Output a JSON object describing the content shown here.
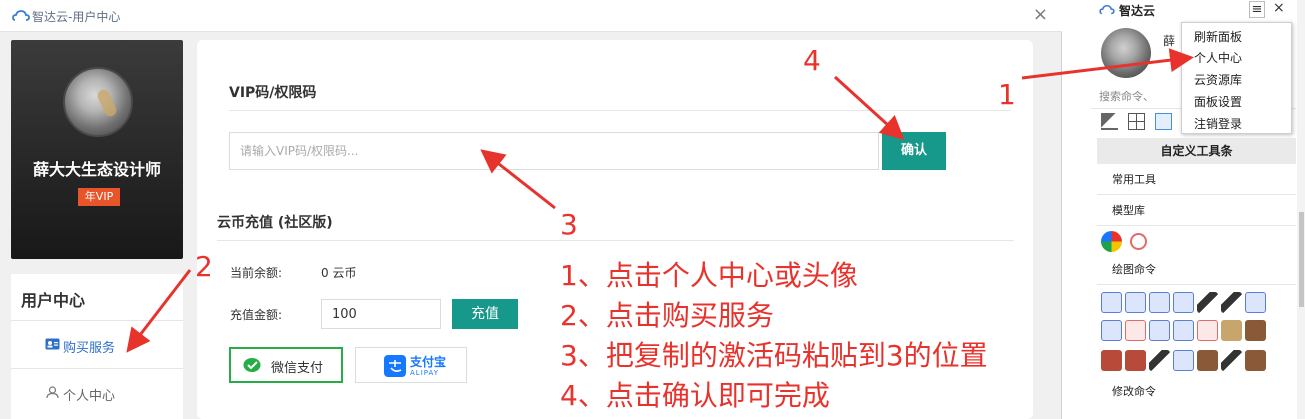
{
  "window": {
    "title": "智达云-用户中心",
    "close_label": "×"
  },
  "profile": {
    "name": "薛大大生态设计师",
    "vip_badge": "年VIP"
  },
  "user_center": {
    "title": "用户中心",
    "items": [
      {
        "label": "购买服务",
        "icon": "member-card-icon"
      },
      {
        "label": "个人中心",
        "icon": "user-icon"
      }
    ]
  },
  "vip_section": {
    "title": "VIP码/权限码",
    "placeholder": "请输入VIP码/权限码...",
    "confirm_label": "确认"
  },
  "coin_section": {
    "title": "云币充值 (社区版)",
    "balance_label": "当前余额:",
    "balance_value": "0 云币",
    "amount_label": "充值金额:",
    "amount_value": "100",
    "recharge_label": "充值",
    "wechat_label": "微信支付",
    "alipay_label": "支付宝",
    "alipay_sub": "ALIPAY"
  },
  "side_panel": {
    "title": "智达云",
    "menu_label": "≡",
    "close_label": "×",
    "name_clip": "薛",
    "search_placeholder": "搜索命令、",
    "toolbar_title": "自定义工具条",
    "sections": [
      "常用工具",
      "模型库",
      "绘图命令",
      "修改命令"
    ]
  },
  "dropdown_menu": [
    "刷新面板",
    "个人中心",
    "云资源库",
    "面板设置",
    "注销登录"
  ],
  "annotations": {
    "numbers": [
      "1",
      "2",
      "3",
      "4"
    ],
    "steps": [
      "1、点击个人中心或头像",
      "2、点击购买服务",
      "3、把复制的激活码粘贴到3的位置",
      "4、点击确认即可完成"
    ]
  },
  "colors": {
    "accent": "#16988a",
    "vip_badge": "#e8552a",
    "annotation": "#e8332d",
    "link": "#2e6fc8"
  }
}
